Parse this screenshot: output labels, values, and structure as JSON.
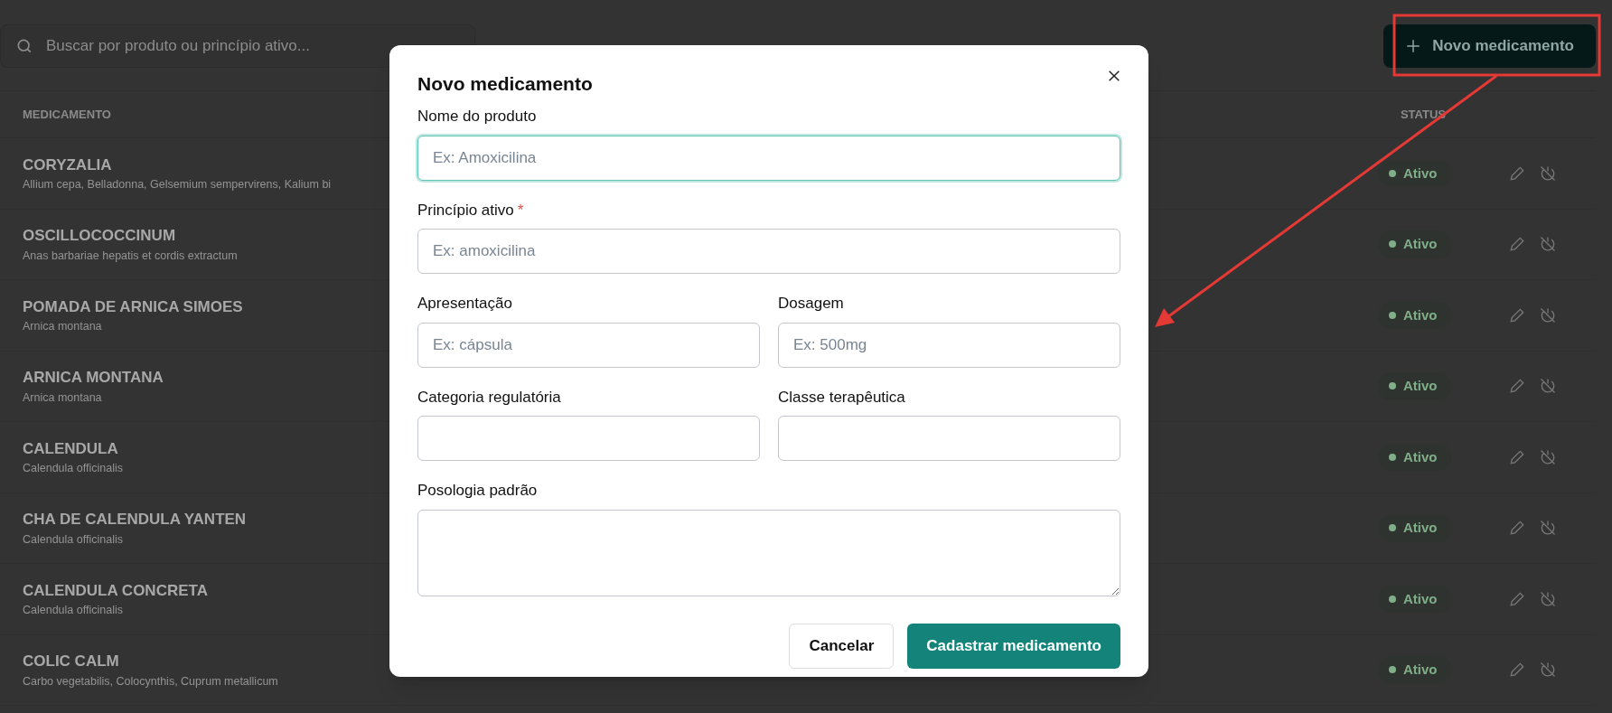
{
  "search": {
    "placeholder": "Buscar por produto ou princípio ativo..."
  },
  "new_button": {
    "label": "Novo medicamento"
  },
  "table": {
    "columns": [
      "MEDICAMENTO",
      "STATUS"
    ],
    "rows": [
      {
        "name": "CORYZALIA",
        "ingredients": "Allium cepa, Belladonna, Gelsemium sempervirens, Kalium bi",
        "status": "Ativo"
      },
      {
        "name": "OSCILLOCOCCINUM",
        "ingredients": "Anas barbariae hepatis et cordis extractum",
        "status": "Ativo"
      },
      {
        "name": "POMADA DE ARNICA SIMOES",
        "ingredients": "Arnica montana",
        "status": "Ativo"
      },
      {
        "name": "ARNICA MONTANA",
        "ingredients": "Arnica montana",
        "status": "Ativo"
      },
      {
        "name": "CALENDULA",
        "ingredients": "Calendula officinalis",
        "status": "Ativo"
      },
      {
        "name": "CHA DE CALENDULA YANTEN",
        "ingredients": "Calendula officinalis",
        "status": "Ativo"
      },
      {
        "name": "CALENDULA CONCRETA",
        "ingredients": "Calendula officinalis",
        "status": "Ativo"
      },
      {
        "name": "COLIC CALM",
        "ingredients": "Carbo vegetabilis, Colocynthis, Cuprum metallicum",
        "status": "Ativo"
      }
    ]
  },
  "modal": {
    "title": "Novo medicamento",
    "field_rows": [
      [
        {
          "label": "Nome do produto",
          "placeholder": "Ex: Amoxicilina",
          "focused": true,
          "kind": "input"
        }
      ],
      [
        {
          "label": "Princípio ativo",
          "required_mark": "*",
          "placeholder": "Ex: amoxicilina",
          "focused": false,
          "kind": "input"
        }
      ],
      [
        {
          "label": "Apresentação",
          "placeholder": "Ex: cápsula",
          "focused": false,
          "kind": "input"
        },
        {
          "label": "Dosagem",
          "placeholder": "Ex: 500mg",
          "focused": false,
          "kind": "input"
        }
      ],
      [
        {
          "label": "Categoria regulatória",
          "focused": false,
          "kind": "input"
        },
        {
          "label": "Classe terapêutica",
          "focused": false,
          "kind": "input"
        }
      ],
      [
        {
          "label": "Posologia padrão",
          "focused": false,
          "kind": "textarea"
        }
      ]
    ],
    "buttons": [
      {
        "label": "Cancelar",
        "kind": "secondary"
      },
      {
        "label": "Cadastrar medicamento",
        "kind": "primary"
      }
    ]
  }
}
